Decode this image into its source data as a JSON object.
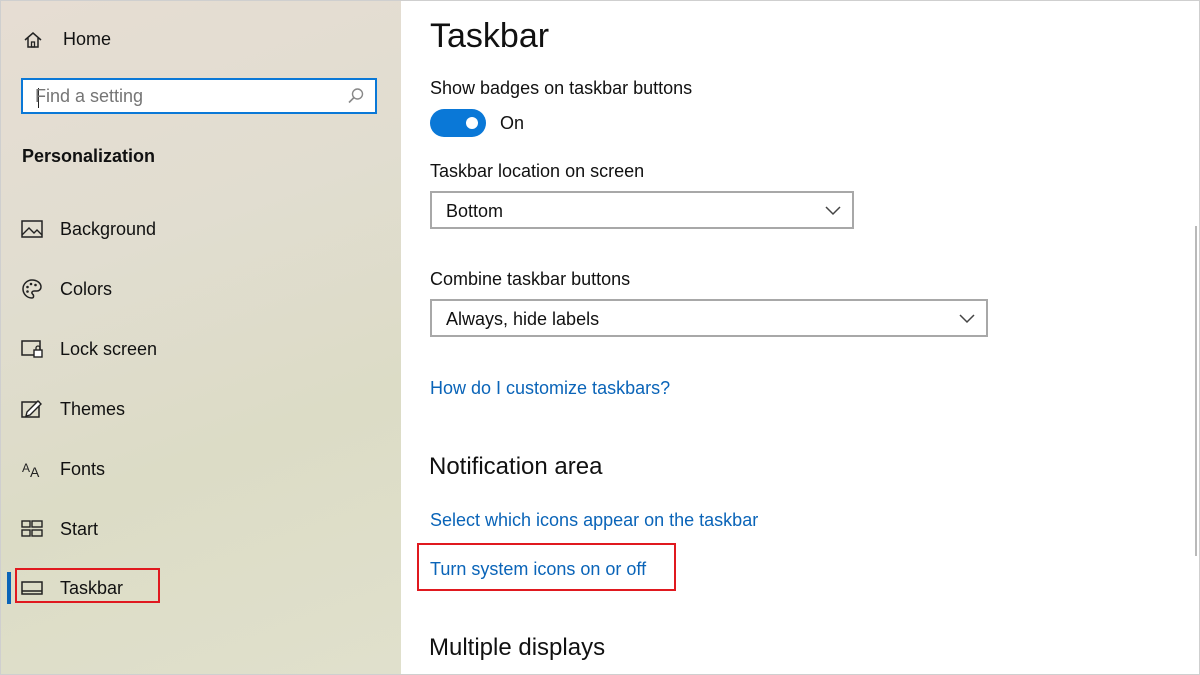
{
  "sidebar": {
    "home_label": "Home",
    "search_placeholder": "Find a setting",
    "section_title": "Personalization",
    "items": [
      {
        "label": "Background",
        "icon": "picture-icon"
      },
      {
        "label": "Colors",
        "icon": "palette-icon"
      },
      {
        "label": "Lock screen",
        "icon": "lock-screen-icon"
      },
      {
        "label": "Themes",
        "icon": "themes-icon"
      },
      {
        "label": "Fonts",
        "icon": "fonts-icon"
      },
      {
        "label": "Start",
        "icon": "start-icon"
      },
      {
        "label": "Taskbar",
        "icon": "taskbar-icon",
        "selected": true
      }
    ]
  },
  "main": {
    "title": "Taskbar",
    "badges": {
      "label": "Show badges on taskbar buttons",
      "state": "On"
    },
    "location": {
      "label": "Taskbar location on screen",
      "value": "Bottom"
    },
    "combine": {
      "label": "Combine taskbar buttons",
      "value": "Always, hide labels"
    },
    "help_link": "How do I customize taskbars?",
    "notification": {
      "header": "Notification area",
      "link1": "Select which icons appear on the taskbar",
      "link2": "Turn system icons on or off"
    },
    "multiple_displays_header": "Multiple displays"
  },
  "colors": {
    "accent": "#0a78d7",
    "link": "#0a64b8",
    "highlight_box": "#e0191f"
  }
}
